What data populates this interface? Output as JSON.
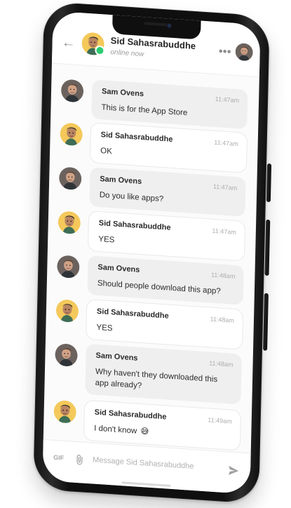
{
  "header": {
    "name": "Sid Sahasrabuddhe",
    "status": "online now",
    "back_icon": "back-arrow-icon",
    "more_icon": "more-horizontal-icon"
  },
  "messages": [
    {
      "sender": "Sam Ovens",
      "time": "11:47am",
      "text": "This is for the App Store",
      "avatar": "sam"
    },
    {
      "sender": "Sid Sahasrabuddhe",
      "time": "11:47am",
      "text": "OK",
      "avatar": "sid"
    },
    {
      "sender": "Sam Ovens",
      "time": "11:47am",
      "text": "Do you like apps?",
      "avatar": "sam"
    },
    {
      "sender": "Sid Sahasrabuddhe",
      "time": "11:47am",
      "text": "YES",
      "avatar": "sid"
    },
    {
      "sender": "Sam Ovens",
      "time": "11:48am",
      "text": "Should people download this app?",
      "avatar": "sam"
    },
    {
      "sender": "Sid Sahasrabuddhe",
      "time": "11:48am",
      "text": "YES",
      "avatar": "sid"
    },
    {
      "sender": "Sam Ovens",
      "time": "11:48am",
      "text": "Why haven't they downloaded this app already?",
      "avatar": "sam"
    },
    {
      "sender": "Sid Sahasrabuddhe",
      "time": "11:49am",
      "text": "I don't know",
      "emoji": "😅",
      "avatar": "sid"
    }
  ],
  "composer": {
    "gif_label": "GIF",
    "placeholder": "Message Sid Sahasrabuddhe",
    "attach_icon": "paperclip-icon",
    "send_icon": "send-icon"
  },
  "colors": {
    "online": "#2ecc71",
    "phone_frame": "#151515",
    "bubble_gray": "#efefef",
    "bubble_white": "#ffffff"
  }
}
